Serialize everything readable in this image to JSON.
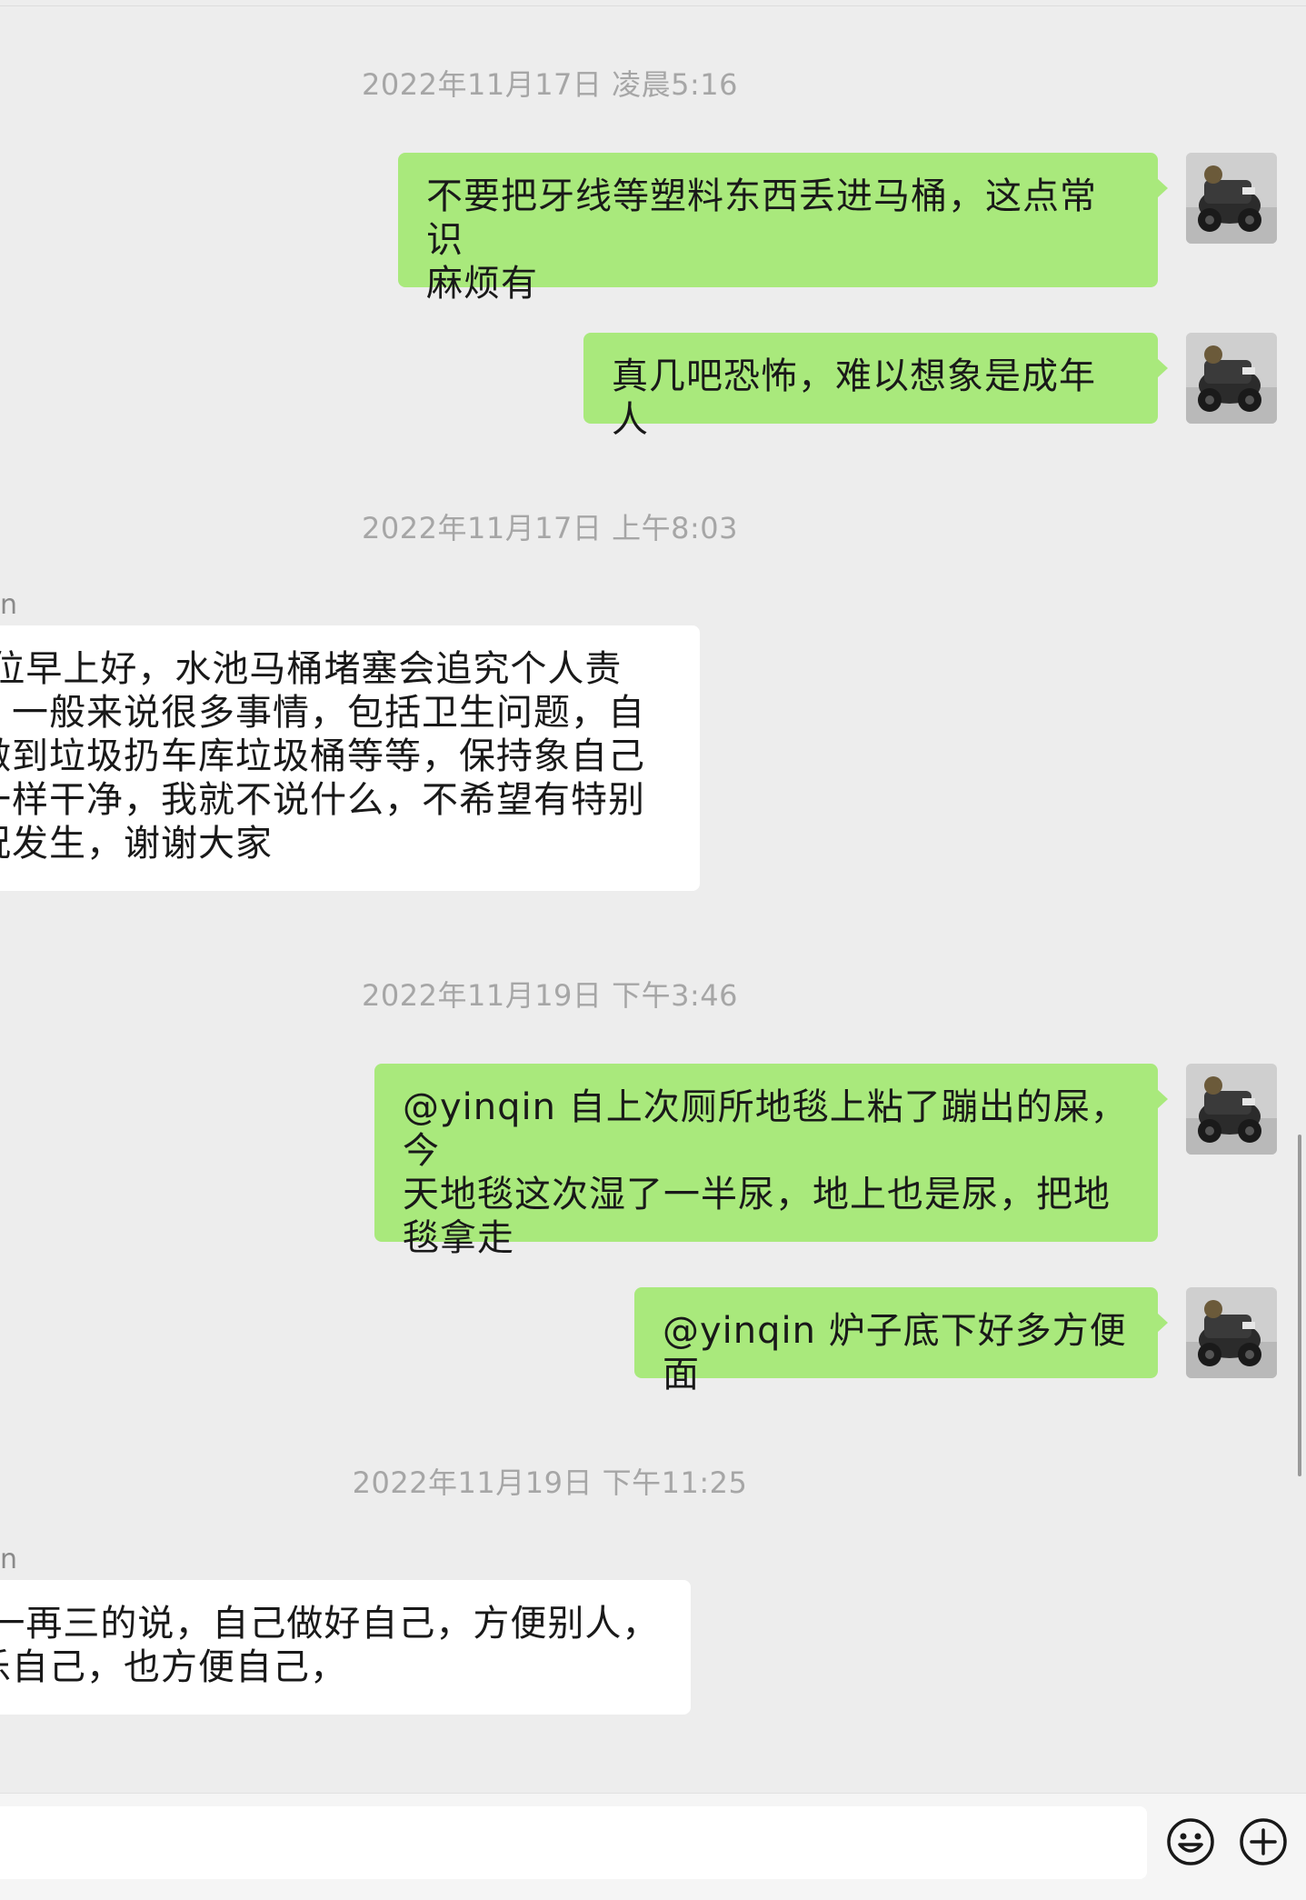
{
  "timestamps": [
    "2022年11月17日 凌晨5:16",
    "2022年11月17日 上午8:03",
    "2022年11月19日 下午3:46",
    "2022年11月19日 下午11:25"
  ],
  "sender_fragments": [
    "n",
    "n"
  ],
  "messages": [
    {
      "direction": "out",
      "text": "不要把牙线等塑料东西丢进马桶，这点常识\n麻烦有"
    },
    {
      "direction": "out",
      "text": "真几吧恐怖，难以想象是成年人"
    },
    {
      "direction": "in",
      "text": "-位早上好，水池马桶堵塞会追究个人责\n，一般来说很多事情，包括卫生问题，自\n做到垃圾扔车库垃圾桶等等，保持象自己\n一样干净，我就不说什么，不希望有特别\n况发生，谢谢大家"
    },
    {
      "direction": "out",
      "text": "@yinqin 自上次厕所地毯上粘了蹦出的屎，今\n天地毯这次湿了一半尿，地上也是尿，把地\n毯拿走"
    },
    {
      "direction": "out",
      "text": "@yinqin 炉子底下好多方便面"
    },
    {
      "direction": "in",
      "text": "-一再三的说，自己做好自己，方便别人，\n乐自己，也方便自己，"
    }
  ],
  "input_bar": {
    "input_value": "",
    "emoji_icon": "emoji-icon",
    "plus_icon": "plus-icon"
  },
  "colors": {
    "background": "#ededed",
    "outgoing_bubble": "#a9e97c",
    "incoming_bubble": "#ffffff",
    "timestamp_text": "#a6a6a6"
  }
}
